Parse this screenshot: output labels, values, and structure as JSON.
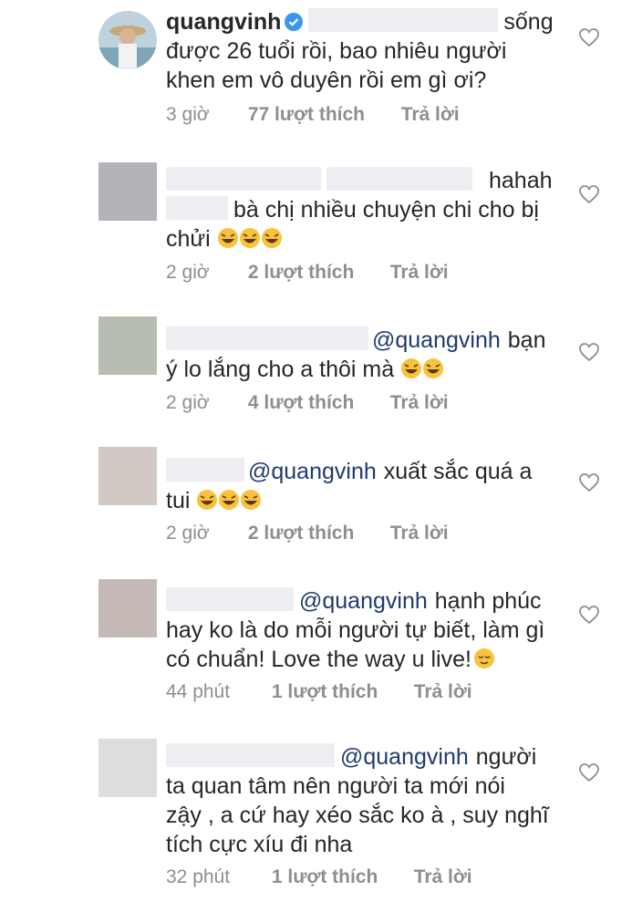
{
  "comments": [
    {
      "username": "quangvinh",
      "verified": true,
      "lines": [
        {
          "mention": "",
          "text": "sống"
        },
        {
          "mention": "",
          "text": "được 26 tuổi rồi, bao nhiêu người"
        },
        {
          "mention": "",
          "text": "khen em vô duyên rồi em gì ơi?"
        }
      ],
      "time": "3 giờ",
      "likes": "77 lượt thích",
      "reply": "Trả lời",
      "avatar_color": "#c9d6dc"
    },
    {
      "lines": [
        {
          "mention": "",
          "text": "hahah"
        },
        {
          "mention": "",
          "text": "bà chị nhiều chuyện chi cho bị"
        },
        {
          "mention": "",
          "text": "chửi"
        }
      ],
      "time": "2 giờ",
      "likes": "2 lượt thích",
      "reply": "Trả lời",
      "avatar_color": "#b3b3b8"
    },
    {
      "lines": [
        {
          "mention": "@quangvinh",
          "text": "bạn"
        },
        {
          "mention": "",
          "text": "ý lo lắng cho a thôi mà"
        }
      ],
      "time": "2 giờ",
      "likes": "4 lượt thích",
      "reply": "Trả lời",
      "avatar_color": "#b7bdb0"
    },
    {
      "lines": [
        {
          "mention": "@quangvinh",
          "text": "xuất sắc quá a"
        },
        {
          "mention": "",
          "text": "tui"
        }
      ],
      "time": "2 giờ",
      "likes": "2 lượt thích",
      "reply": "Trả lời",
      "avatar_color": "#d2c8c4"
    },
    {
      "lines": [
        {
          "mention": "@quangvinh",
          "text": "hạnh phúc"
        },
        {
          "mention": "",
          "text": "hay ko là do mỗi người tự biết, làm gì"
        },
        {
          "mention": "",
          "text": "có chuẩn! Love the way u live!"
        }
      ],
      "time": "44 phút",
      "likes": "1 lượt thích",
      "reply": "Trả lời",
      "avatar_color": "#c5b9b5"
    },
    {
      "lines": [
        {
          "mention": "@quangvinh",
          "text": "người"
        },
        {
          "mention": "",
          "text": "ta quan tâm nên người ta mới nói"
        },
        {
          "mention": "",
          "text": "zậy , a cứ hay xéo sắc ko à , suy nghĩ"
        },
        {
          "mention": "",
          "text": "tích cực xíu đi nha"
        }
      ],
      "time": "32 phút",
      "likes": "1 lượt thích",
      "reply": "Trả lời",
      "avatar_color": "#dedcdc"
    }
  ],
  "colors": {
    "text": "#262626",
    "meta": "#8e8e8e",
    "mention": "#1f3b6e",
    "verified": "#3897f0"
  }
}
